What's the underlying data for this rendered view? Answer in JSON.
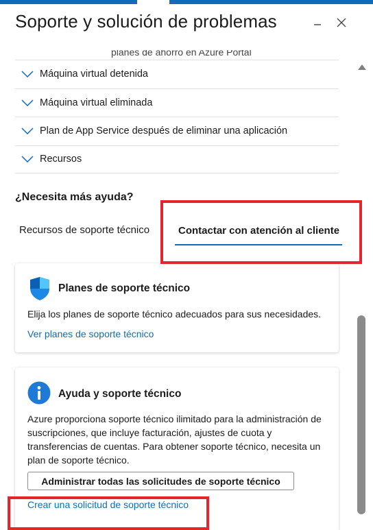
{
  "header": {
    "title": "Soporte y solución de problemas",
    "minimize_icon": "minimize-icon",
    "close_icon": "close-icon"
  },
  "accordion": {
    "cutoff_text": "planes de ahorro en Azure Portal",
    "items": [
      {
        "label": "Máquina virtual detenida",
        "icon": "chevron-down-icon"
      },
      {
        "label": "Máquina virtual eliminada",
        "icon": "chevron-down-icon"
      },
      {
        "label": "Plan de App Service después de eliminar una aplicación",
        "icon": "chevron-down-icon"
      },
      {
        "label": "Recursos",
        "icon": "chevron-down-icon"
      }
    ]
  },
  "help": {
    "heading": "¿Necesita más ayuda?",
    "tabs": [
      {
        "label": "Recursos de soporte técnico",
        "selected": false
      },
      {
        "label": "Contactar con atención al cliente",
        "selected": true
      }
    ]
  },
  "cards": {
    "plans": {
      "icon": "shield-icon",
      "title": "Planes de soporte técnico",
      "body": "Elija los planes de soporte técnico adecuados para sus necesidades.",
      "link": "Ver planes de soporte técnico"
    },
    "support": {
      "icon": "info-icon",
      "title": "Ayuda y soporte técnico",
      "body": "Azure proporciona soporte técnico ilimitado para la administración de suscripciones, que incluye facturación, ajustes de cuota y transferencias de cuentas. Para obtener soporte técnico, necesita un plan de soporte técnico.",
      "button": "Administrar todas las solicitudes de soporte técnico",
      "link": "Crear una solicitud de soporte técnico"
    }
  },
  "colors": {
    "accent": "#0f6cbd",
    "highlight": "#e3262b",
    "scrollbar_thumb": "#8b8b8b"
  }
}
